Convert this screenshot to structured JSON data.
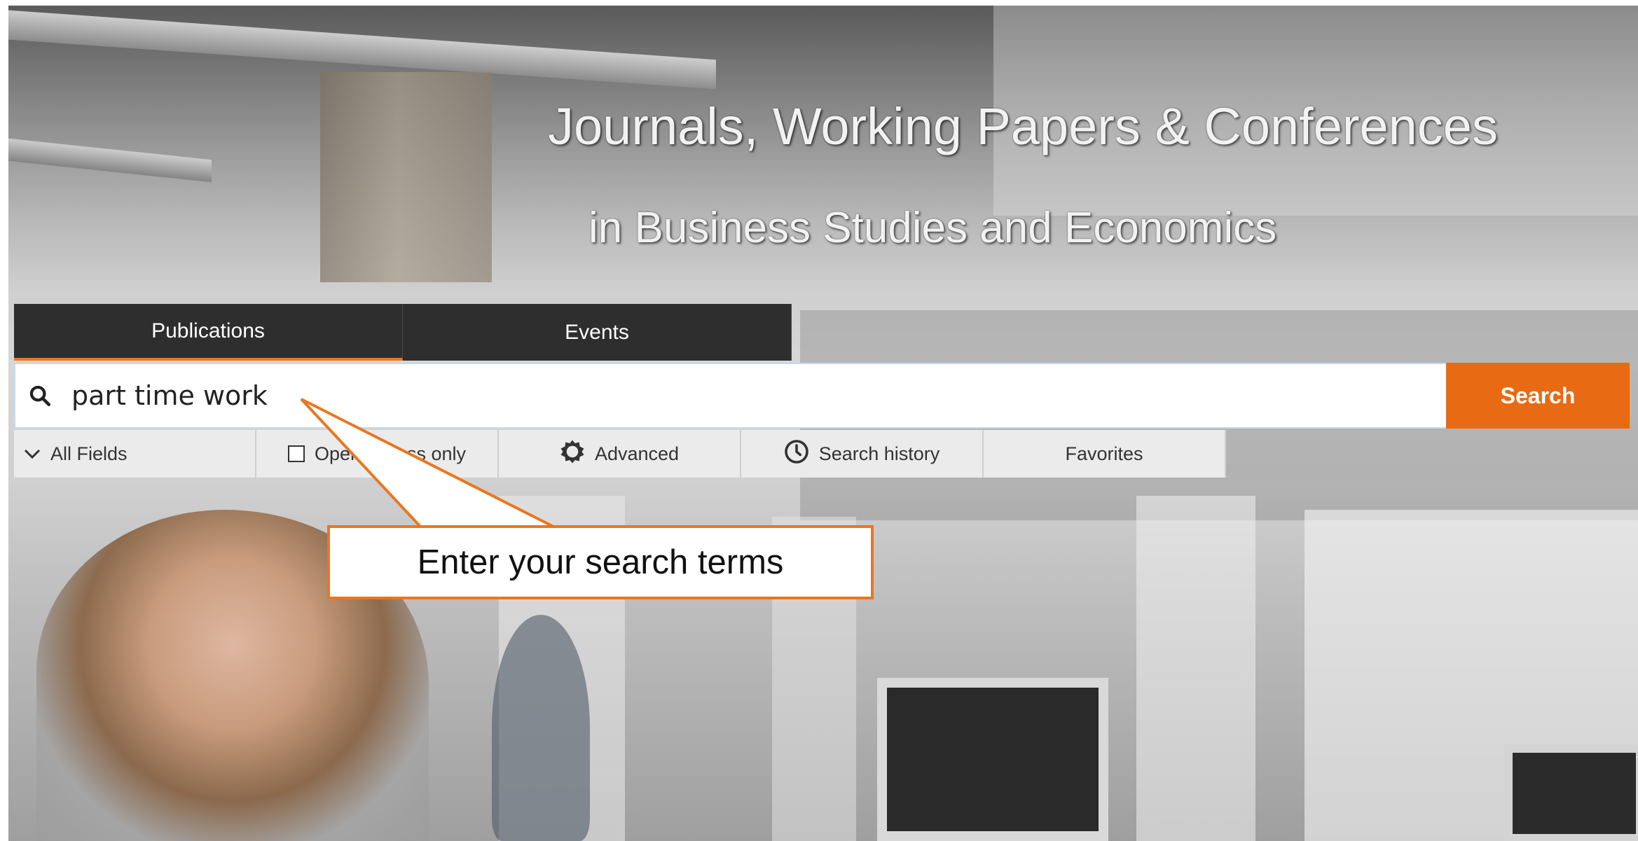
{
  "hero": {
    "title": "Journals, Working Papers & Conferences",
    "subtitle": "in Business Studies and Economics"
  },
  "tabs": [
    {
      "label": "Publications",
      "active": true
    },
    {
      "label": "Events",
      "active": false
    }
  ],
  "search": {
    "value": "part time work",
    "button_label": "Search",
    "icon": "search-icon"
  },
  "options": {
    "fields": {
      "label": "All Fields",
      "icon": "chevron-down-icon"
    },
    "open_access": {
      "label": "Open Access only",
      "checked": false
    },
    "advanced": {
      "label": "Advanced",
      "icon": "gear-icon"
    },
    "history": {
      "label": "Search history",
      "icon": "clock-icon"
    },
    "favorites": {
      "label": "Favorites"
    }
  },
  "callout": {
    "text": "Enter your search terms"
  },
  "colors": {
    "accent": "#e87722",
    "button": "#e86a12",
    "tab_bg": "#2e2e2e"
  }
}
